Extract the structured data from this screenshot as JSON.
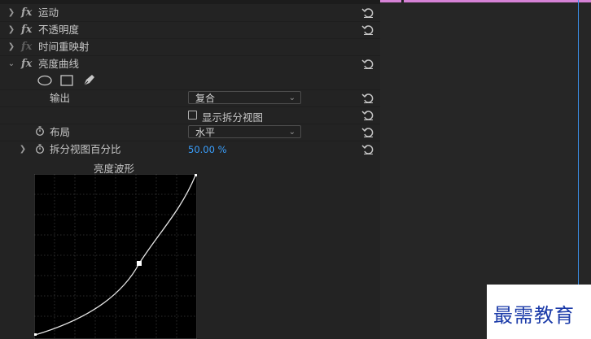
{
  "effects": [
    {
      "label": "运动",
      "enabled": true
    },
    {
      "label": "不透明度",
      "enabled": true
    },
    {
      "label": "时间重映射",
      "enabled": false
    },
    {
      "label": "亮度曲线",
      "enabled": true
    }
  ],
  "luma_curve": {
    "output_label": "输出",
    "output_value": "复合",
    "split_view_label": "显示拆分视图",
    "layout_label": "布局",
    "layout_value": "水平",
    "split_percent_label": "拆分视图百分比",
    "split_percent_value": "50.00 %",
    "curve_title": "亮度波形"
  },
  "icons": [
    "ellipse-mask-icon",
    "rectangle-mask-icon",
    "pen-mask-icon",
    "reset-icon",
    "stopwatch-icon",
    "chevron-right-icon",
    "chevron-down-icon"
  ],
  "colors": {
    "accent_blue": "#3aa0ff",
    "clip_bar": "#d682d6",
    "playhead": "#3a8ee6",
    "watermark": "#1a3aa8"
  },
  "watermark": "最需教育"
}
